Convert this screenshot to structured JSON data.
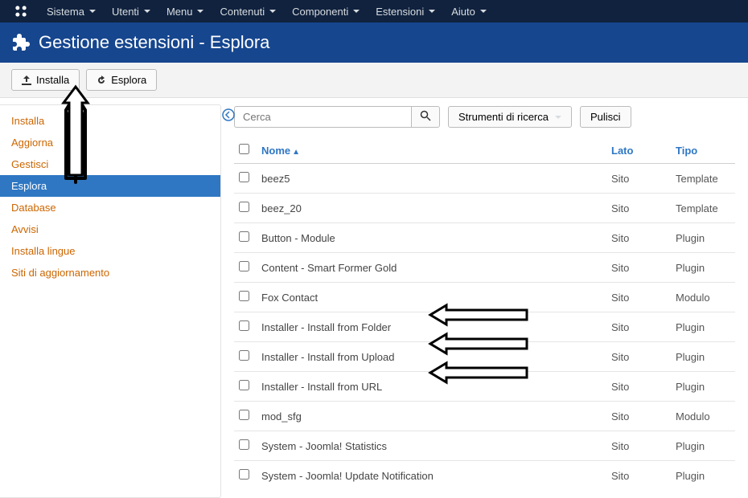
{
  "topMenu": [
    "Sistema",
    "Utenti",
    "Menu",
    "Contenuti",
    "Componenti",
    "Estensioni",
    "Aiuto"
  ],
  "pageTitle": "Gestione estensioni - Esplora",
  "toolbar": {
    "install": "Installa",
    "discover": "Esplora"
  },
  "sidebar": {
    "items": [
      "Installa",
      "Aggiorna",
      "Gestisci",
      "Esplora",
      "Database",
      "Avvisi",
      "Installa lingue",
      "Siti di aggiornamento"
    ],
    "activeIndex": 3
  },
  "search": {
    "placeholder": "Cerca",
    "toolsLabel": "Strumenti di ricerca",
    "clearLabel": "Pulisci"
  },
  "table": {
    "headers": {
      "name": "Nome",
      "side": "Lato",
      "type": "Tipo"
    },
    "rows": [
      {
        "name": "beez5",
        "side": "Sito",
        "type": "Template"
      },
      {
        "name": "beez_20",
        "side": "Sito",
        "type": "Template"
      },
      {
        "name": "Button - Module",
        "side": "Sito",
        "type": "Plugin"
      },
      {
        "name": "Content - Smart Former Gold",
        "side": "Sito",
        "type": "Plugin"
      },
      {
        "name": "Fox Contact",
        "side": "Sito",
        "type": "Modulo"
      },
      {
        "name": "Installer - Install from Folder",
        "side": "Sito",
        "type": "Plugin"
      },
      {
        "name": "Installer - Install from Upload",
        "side": "Sito",
        "type": "Plugin"
      },
      {
        "name": "Installer - Install from URL",
        "side": "Sito",
        "type": "Plugin"
      },
      {
        "name": "mod_sfg",
        "side": "Sito",
        "type": "Modulo"
      },
      {
        "name": "System - Joomla! Statistics",
        "side": "Sito",
        "type": "Plugin"
      },
      {
        "name": "System - Joomla! Update Notification",
        "side": "Sito",
        "type": "Plugin"
      }
    ]
  }
}
